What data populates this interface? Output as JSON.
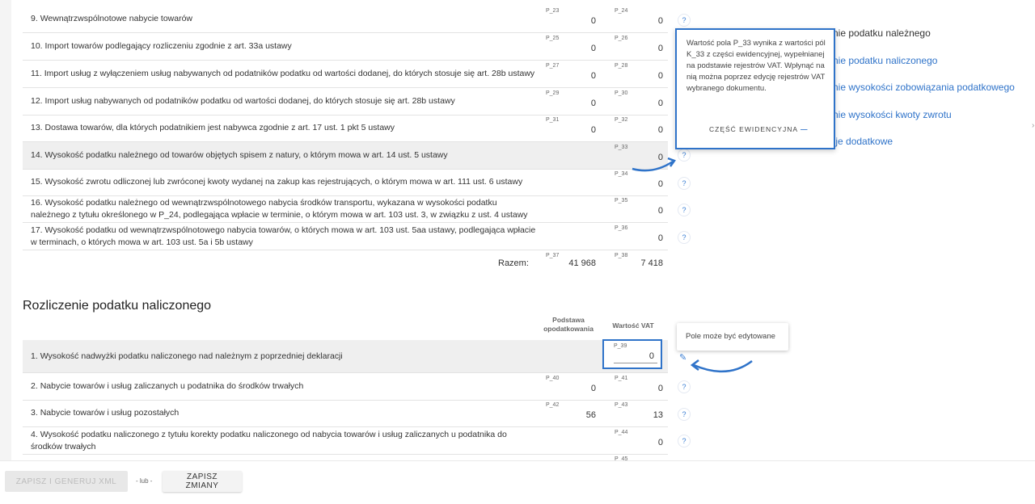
{
  "vat_due": {
    "rows": [
      {
        "num": "9.",
        "label": "Wewnątrzwspólnotowe nabycie towarów",
        "base_code": "P_23",
        "base_value": "0",
        "vat_code": "P_24",
        "vat_value": "0"
      },
      {
        "num": "10.",
        "label": "Import towarów podlegający rozliczeniu zgodnie z art. 33a ustawy",
        "base_code": "P_25",
        "base_value": "0",
        "vat_code": "P_26",
        "vat_value": "0"
      },
      {
        "num": "11.",
        "label": "Import usług z wyłączeniem usług nabywanych od podatników podatku od wartości dodanej, do których stosuje się art. 28b ustawy",
        "base_code": "P_27",
        "base_value": "0",
        "vat_code": "P_28",
        "vat_value": "0"
      },
      {
        "num": "12.",
        "label": "Import usług nabywanych od podatników podatku od wartości dodanej, do których stosuje się art. 28b ustawy",
        "base_code": "P_29",
        "base_value": "0",
        "vat_code": "P_30",
        "vat_value": "0"
      },
      {
        "num": "13.",
        "label": "Dostawa towarów, dla których podatnikiem jest nabywca zgodnie z art. 17 ust. 1 pkt 5 ustawy",
        "base_code": "P_31",
        "base_value": "0",
        "vat_code": "P_32",
        "vat_value": "0"
      },
      {
        "num": "14.",
        "label": "Wysokość podatku należnego od towarów objętych spisem z natury, o którym mowa w art. 14 ust. 5 ustawy",
        "base_code": "",
        "base_value": "",
        "vat_code": "P_33",
        "vat_value": "0"
      },
      {
        "num": "15.",
        "label": "Wysokość zwrotu odliczonej lub zwróconej kwoty wydanej na zakup kas rejestrujących, o którym mowa w art. 111 ust. 6 ustawy",
        "base_code": "",
        "base_value": "",
        "vat_code": "P_34",
        "vat_value": "0"
      },
      {
        "num": "16.",
        "label": "Wysokość podatku należnego od wewnątrzwspólnotowego nabycia środków transportu, wykazana w wysokości podatku należnego z tytułu określonego w P_24, podlegająca wpłacie w terminie, o którym mowa w art. 103 ust. 3, w związku z ust. 4 ustawy",
        "base_code": "",
        "base_value": "",
        "vat_code": "P_35",
        "vat_value": "0"
      },
      {
        "num": "17.",
        "label": "Wysokość podatku od wewnątrzwspólnotowego nabycia towarów, o których mowa w art. 103 ust. 5aa ustawy, podlegająca wpłacie w terminach, o których mowa w art. 103 ust. 5a i 5b ustawy",
        "base_code": "",
        "base_value": "",
        "vat_code": "P_36",
        "vat_value": "0"
      }
    ],
    "total": {
      "label": "Razem:",
      "base_code": "P_37",
      "base_value": "41 968",
      "vat_code": "P_38",
      "vat_value": "7 418"
    }
  },
  "vat_input": {
    "title": "Rozliczenie podatku naliczonego",
    "col_base": "Podstawa opodatkowania",
    "col_vat": "Wartość VAT",
    "rows": [
      {
        "num": "1.",
        "label": "Wysokość nadwyżki podatku naliczonego nad należnym z poprzedniej deklaracji",
        "base_code": "",
        "base_value": "",
        "vat_code": "P_39",
        "vat_value": "0"
      },
      {
        "num": "2.",
        "label": "Nabycie towarów i usług zaliczanych u podatnika do środków trwałych",
        "base_code": "P_40",
        "base_value": "0",
        "vat_code": "P_41",
        "vat_value": "0"
      },
      {
        "num": "3.",
        "label": "Nabycie towarów i usług pozostałych",
        "base_code": "P_42",
        "base_value": "56",
        "vat_code": "P_43",
        "vat_value": "13"
      },
      {
        "num": "4.",
        "label": "Wysokość podatku naliczonego z tytułu korekty podatku naliczonego od nabycia towarów i usług zaliczanych u podatnika do środków trwałych",
        "base_code": "",
        "base_value": "",
        "vat_code": "P_44",
        "vat_value": "0"
      }
    ],
    "partial_code": "P_45"
  },
  "help_symbol": "?",
  "edit_symbol": "✎",
  "right_nav": [
    "zliczenie podatku należnego",
    "zliczenie podatku naliczonego",
    "zliczenie wysokości zobowiązania podatkowego",
    "zliczenie wysokości kwoty zwrotu",
    "ormacje dodatkowe"
  ],
  "tooltip_p33": {
    "text": "Wartość pola P_33 wynika z wartości pól K_33 z części ewidencyjnej, wypełnianej na podstawie rejestrów VAT. Wpłynąć na nią można poprzez edycję rejestrów VAT wybranego dokumentu.",
    "link": "CZĘŚĆ EWIDENCYJNA",
    "link_icon": "—"
  },
  "tooltip_edit": {
    "text": "Pole może być edytowane"
  },
  "footer": {
    "generate_button": "ZAPISZ I GENERUJ XML",
    "or_text": "- lub -",
    "save_button": "ZAPISZ ZMIANY"
  },
  "colors": {
    "accent": "#2f73c9",
    "highlight_row": "#efefef",
    "help_icon": "#3b7fd4"
  }
}
